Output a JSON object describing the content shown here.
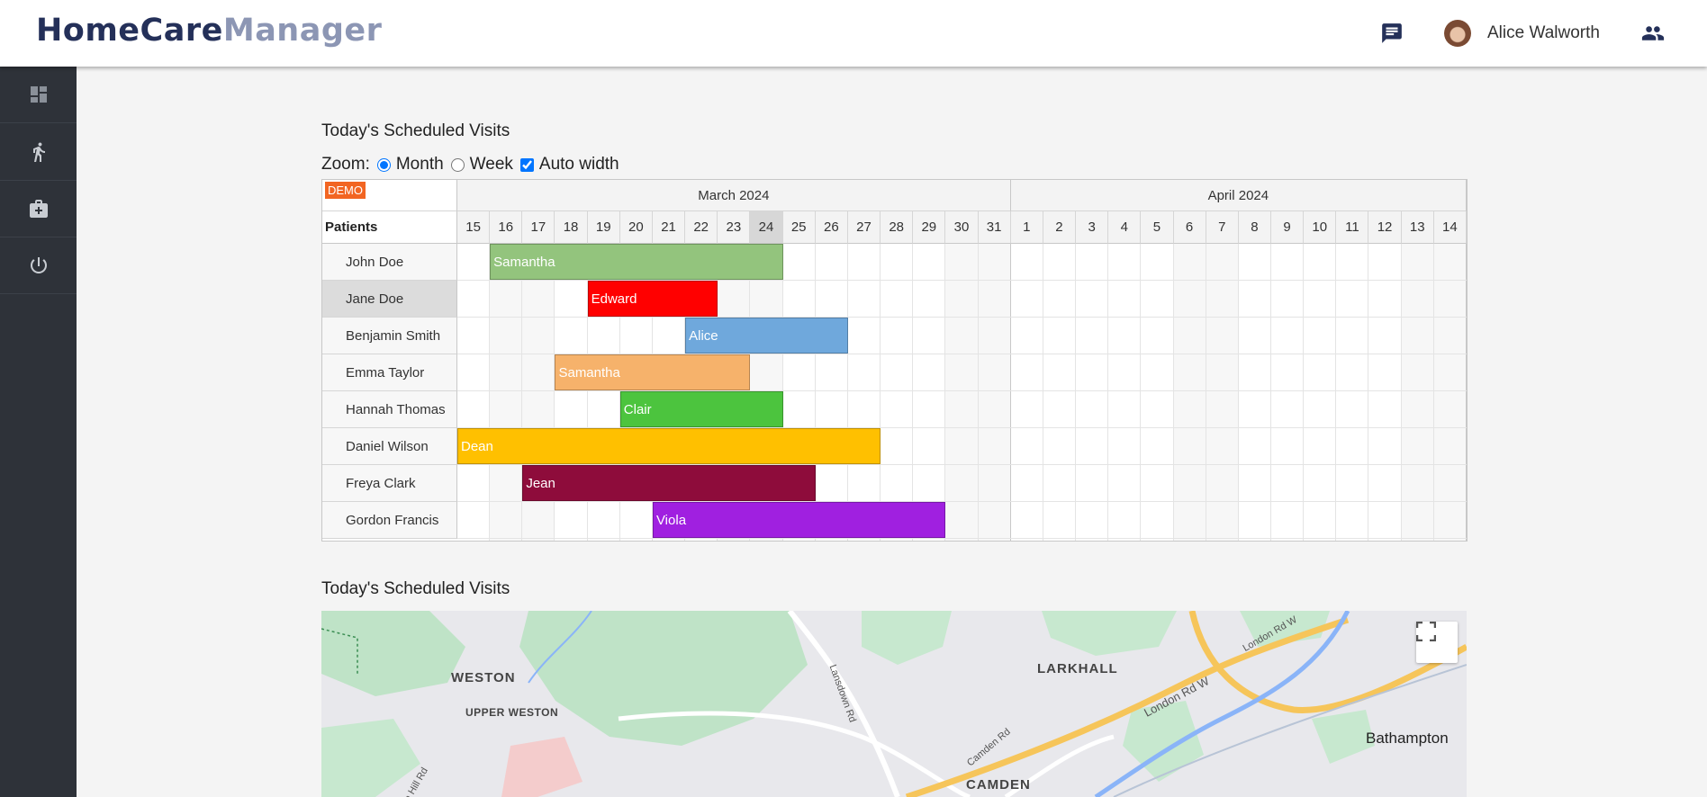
{
  "app": {
    "logo_part1": "HomeCare",
    "logo_part2": "Manager"
  },
  "header": {
    "username": "Alice Walworth",
    "icons": [
      "chat-icon",
      "avatar",
      "people-icon"
    ]
  },
  "sidebar": {
    "items": [
      {
        "name": "dashboard",
        "icon": "dashboard-icon"
      },
      {
        "name": "patients",
        "icon": "walking-person-icon"
      },
      {
        "name": "visits",
        "icon": "medical-bag-icon"
      },
      {
        "name": "logout",
        "icon": "power-icon"
      }
    ]
  },
  "schedule": {
    "title": "Today's Scheduled Visits",
    "zoom_label": "Zoom:",
    "zoom_options": [
      {
        "label": "Month",
        "checked": true
      },
      {
        "label": "Week",
        "checked": false
      }
    ],
    "auto_width_label": "Auto width",
    "auto_width_checked": true,
    "demo_badge": "DEMO",
    "patients_header": "Patients",
    "months": [
      {
        "label": "March 2024",
        "days": [
          "15",
          "16",
          "17",
          "18",
          "19",
          "20",
          "21",
          "22",
          "23",
          "24",
          "25",
          "26",
          "27",
          "28",
          "29",
          "30",
          "31"
        ]
      },
      {
        "label": "April 2024",
        "days": [
          "1",
          "2",
          "3",
          "4",
          "5",
          "6",
          "7",
          "8",
          "9",
          "10",
          "11",
          "12",
          "13",
          "14"
        ]
      }
    ],
    "today_day": "24",
    "weekend_days": [
      "16",
      "17",
      "23",
      "24",
      "30",
      "31",
      "6",
      "7",
      "13",
      "14"
    ],
    "rows": [
      {
        "patient": "John Doe",
        "carer": "Samantha",
        "start": "2024-03-16",
        "end": "2024-03-25",
        "color": "#93c47d",
        "selected": false
      },
      {
        "patient": "Jane Doe",
        "carer": "Edward",
        "start": "2024-03-19",
        "end": "2024-03-23",
        "color": "#ff0000",
        "selected": true
      },
      {
        "patient": "Benjamin Smith",
        "carer": "Alice",
        "start": "2024-03-22",
        "end": "2024-03-27",
        "color": "#6fa8dc",
        "selected": false
      },
      {
        "patient": "Emma Taylor",
        "carer": "Samantha",
        "start": "2024-03-18",
        "end": "2024-03-24",
        "color": "#f6b26b",
        "selected": false
      },
      {
        "patient": "Hannah Thomas",
        "carer": "Clair",
        "start": "2024-03-20",
        "end": "2024-03-25",
        "color": "#4cc43e",
        "selected": false
      },
      {
        "patient": "Daniel Wilson",
        "carer": "Dean",
        "start": "2024-03-15",
        "end": "2024-03-28",
        "color": "#ffc000",
        "selected": false
      },
      {
        "patient": "Freya Clark",
        "carer": "Jean",
        "start": "2024-03-17",
        "end": "2024-03-26",
        "color": "#8e0c3b",
        "selected": false
      },
      {
        "patient": "Gordon Francis",
        "carer": "Viola",
        "start": "2024-03-21",
        "end": "2024-03-30",
        "color": "#a020e0",
        "selected": false
      }
    ]
  },
  "map_section": {
    "title": "Today's Scheduled Visits",
    "labels": {
      "weston": "WESTON",
      "upper_weston": "UPPER WESTON",
      "larkhall": "LARKHALL",
      "camden": "CAMDEN",
      "bathampton": "Bathampton",
      "lansdown_rd": "Lansdown Rd",
      "camden_rd": "Camden Rd",
      "london_rd_w": "London Rd W",
      "london_rd_w2": "London Rd W",
      "primrose_hill_rd": "nn Hill Rd"
    }
  }
}
